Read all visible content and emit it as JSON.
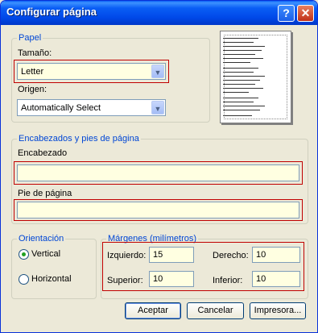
{
  "window": {
    "title": "Configurar página",
    "help_label": "?",
    "close_label": "✕"
  },
  "paper": {
    "legend": "Papel",
    "size_label": "Tamaño:",
    "size_value": "Letter",
    "source_label": "Origen:",
    "source_value": "Automatically Select"
  },
  "headers": {
    "legend": "Encabezados y pies de página",
    "header_label": "Encabezado",
    "header_value": "",
    "footer_label": "Pie de página",
    "footer_value": ""
  },
  "orientation": {
    "legend": "Orientación",
    "portrait_label": "Vertical",
    "landscape_label": "Horizontal",
    "selected": "Vertical"
  },
  "margins": {
    "legend": "Márgenes (milímetros)",
    "left_label": "Izquierdo:",
    "left_value": "15",
    "right_label": "Derecho:",
    "right_value": "10",
    "top_label": "Superior:",
    "top_value": "10",
    "bottom_label": "Inferior:",
    "bottom_value": "10"
  },
  "buttons": {
    "ok": "Aceptar",
    "cancel": "Cancelar",
    "printer": "Impresora..."
  }
}
